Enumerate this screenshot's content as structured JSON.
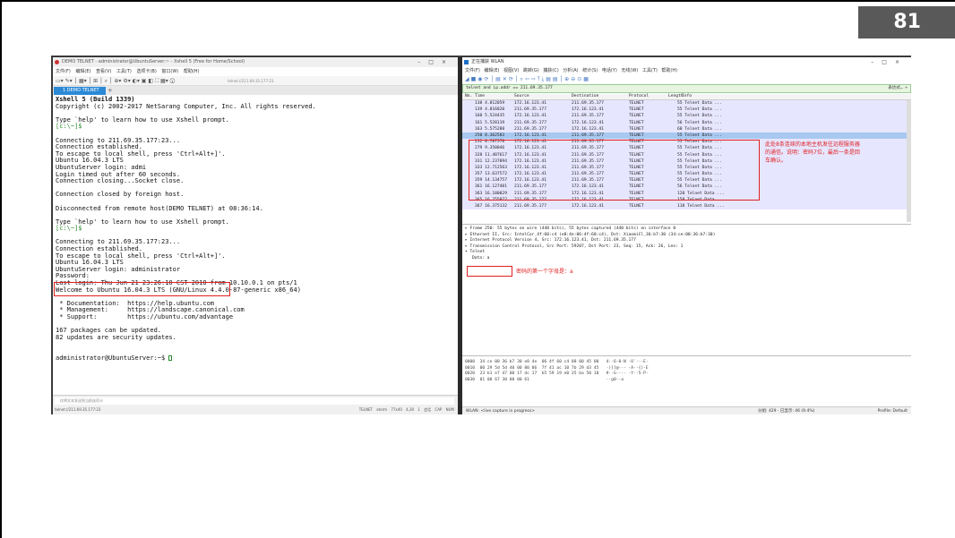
{
  "page_number": "81",
  "xshell": {
    "title": "DEMO TELNET - administrator@UbuntuServer:~ - Xshell 5 (Free for Home/School)",
    "menu": "文件(F) 编辑(E) 查看(V) 工具(T) 选项卡(B) 窗口(W) 帮助(H)",
    "address": "telnet://211.69.35.177:23",
    "tab_label": "1 DEMO TELNET",
    "terminal_lines": [
      {
        "text": "Xshell 5 (Build 1339)",
        "bold": true
      },
      {
        "text": "Copyright (c) 2002-2017 NetSarang Computer, Inc. All rights reserved."
      },
      {
        "text": ""
      },
      {
        "text": "Type `help' to learn how to use Xshell prompt."
      },
      {
        "text": "[c:\\~]$",
        "green": true
      },
      {
        "text": ""
      },
      {
        "text": "Connecting to 211.69.35.177:23..."
      },
      {
        "text": "Connection established."
      },
      {
        "text": "To escape to local shell, press 'Ctrl+Alt+]'."
      },
      {
        "text": "Ubuntu 16.04.3 LTS"
      },
      {
        "text": "UbuntuServer login: admi"
      },
      {
        "text": "Login timed out after 60 seconds."
      },
      {
        "text": "Connection closing...Socket close."
      },
      {
        "text": ""
      },
      {
        "text": "Connection closed by foreign host."
      },
      {
        "text": ""
      },
      {
        "text": "Disconnected from remote host(DEMO TELNET) at 08:36:14."
      },
      {
        "text": ""
      },
      {
        "text": "Type `help' to learn how to use Xshell prompt."
      },
      {
        "text": "[c:\\~]$",
        "green": true
      },
      {
        "text": ""
      },
      {
        "text": "Connecting to 211.69.35.177:23..."
      },
      {
        "text": "Connection established."
      },
      {
        "text": "To escape to local shell, press 'Ctrl+Alt+]'."
      },
      {
        "text": "Ubuntu 16.04.3 LTS"
      },
      {
        "text": "UbuntuServer login: administrator"
      },
      {
        "text": "Password:"
      },
      {
        "text": "Last login: Thu Jun 21 23:26:18 CST 2018 from 10.10.0.1 on pts/1"
      },
      {
        "text": "Welcome to Ubuntu 16.04.3 LTS (GNU/Linux 4.4.0-87-generic x86_64)"
      },
      {
        "text": ""
      },
      {
        "text": " * Documentation:  https://help.ubuntu.com"
      },
      {
        "text": " * Management:     https://landscape.canonical.com"
      },
      {
        "text": " * Support:        https://ubuntu.com/advantage"
      },
      {
        "text": ""
      },
      {
        "text": "167 packages can be updated."
      },
      {
        "text": "82 updates are security updates."
      },
      {
        "text": ""
      },
      {
        "text": ""
      },
      {
        "text": "administrator@UbuntuServer:~$ ",
        "cursor": true
      }
    ],
    "input_hint": "仅将文本发送到当前选项卡",
    "status_left": "telnet://211.69.35.177:23",
    "status_right": "TELNET   xterm   77x40   4,30   1 会话   CAP NUM"
  },
  "wireshark": {
    "title": "正在捕获 WLAN",
    "menu": "文件(F) 编辑(E) 视图(V) 跳转(G) 捕获(C) 分析(A) 统计(S) 电话(Y) 无线(W) 工具(T) 帮助(H)",
    "filter": "telnet and ip.addr == 211.69.35.177",
    "filter_right": "表达式…  +",
    "columns": [
      "No.",
      "Time",
      "Source",
      "Destination",
      "Protocol",
      "Length",
      "Info"
    ],
    "packets": [
      [
        "138",
        "4.812059",
        "172.16.123.41",
        "211.69.35.177",
        "TELNET",
        "55",
        "Telnet Data ..."
      ],
      [
        "139",
        "4.816820",
        "211.69.35.177",
        "172.16.123.41",
        "TELNET",
        "55",
        "Telnet Data ..."
      ],
      [
        "160",
        "5.524435",
        "172.16.123.41",
        "211.69.35.177",
        "TELNET",
        "55",
        "Telnet Data ..."
      ],
      [
        "161",
        "5.528119",
        "211.69.35.177",
        "172.16.123.41",
        "TELNET",
        "56",
        "Telnet Data ..."
      ],
      [
        "163",
        "5.575288",
        "211.69.35.177",
        "172.16.123.41",
        "TELNET",
        "60",
        "Telnet Data ..."
      ],
      [
        "250",
        "8.362583",
        "172.16.123.41",
        "211.69.35.177",
        "TELNET",
        "55",
        "Telnet Data ..."
      ],
      [
        "252",
        "8.787578",
        "172.16.123.41",
        "211.69.35.177",
        "TELNET",
        "55",
        "Telnet Data ..."
      ],
      [
        "279",
        "9.350046",
        "172.16.123.41",
        "211.69.35.177",
        "TELNET",
        "55",
        "Telnet Data ..."
      ],
      [
        "328",
        "11.487617",
        "172.16.123.41",
        "211.69.35.177",
        "TELNET",
        "55",
        "Telnet Data ..."
      ],
      [
        "331",
        "12.237094",
        "172.16.123.41",
        "211.69.35.177",
        "TELNET",
        "55",
        "Telnet Data ..."
      ],
      [
        "333",
        "12.712563",
        "172.16.123.41",
        "211.69.35.177",
        "TELNET",
        "55",
        "Telnet Data ..."
      ],
      [
        "357",
        "13.637572",
        "172.16.123.41",
        "211.69.35.177",
        "TELNET",
        "55",
        "Telnet Data ..."
      ],
      [
        "359",
        "14.134757",
        "172.16.123.41",
        "211.69.35.177",
        "TELNET",
        "55",
        "Telnet Data ..."
      ],
      [
        "361",
        "16.127401",
        "211.69.35.177",
        "172.16.123.41",
        "TELNET",
        "56",
        "Telnet Data ..."
      ],
      [
        "363",
        "16.180029",
        "211.69.35.177",
        "172.16.123.41",
        "TELNET",
        "120",
        "Telnet Data ..."
      ],
      [
        "365",
        "16.255872",
        "211.69.35.177",
        "172.16.123.41",
        "TELNET",
        "158",
        "Telnet Data ..."
      ],
      [
        "367",
        "16.375132",
        "211.69.35.177",
        "172.16.123.41",
        "TELNET",
        "118",
        "Telnet Data ..."
      ]
    ],
    "selected_index": 5,
    "note_packets": "此处8条连续的本地主机发往远程服务器的通信。说明：密码7位，最后一条是回车确认。",
    "details": [
      "Frame 250: 55 bytes on wire (440 bits), 55 bytes captured (440 bits) on interface 0",
      "Ethernet II, Src: IntelCor_4f:60:c4 (e8:4e:06:4f:60:c4), Dst: XiaomiCl_36:b7:30 (34:ce:00:36:b7:30)",
      "Internet Protocol Version 4, Src: 172.16.123.41, Dst: 211.69.35.177",
      "Transmission Control Protocol, Src Port: 59207, Dst Port: 23, Seq: 15, Ack: 26, Len: 1",
      "Telnet",
      "Data: a"
    ],
    "note_data": "密码的第一个字母是：a",
    "hex": [
      "0000  34 ce 00 36 b7 30 e8 4e  06 4f 60 c4 08 00 45 00   4··6·0·N ·O`···E·",
      "0010  00 29 5d 5d 40 00 80 06  7f 41 ac 10 7b 29 d3 45   ·)]]@··· ·A··{)·E",
      "0020  23 b1 e7 47 00 17 dc 17  b5 59 19 e0 35 ba 50 18   #··G···· ·Y··5·P·",
      "0030  01 00 67 30 00 00 61                               ··g0··a"
    ],
    "status_left": "WLAN: <live capture in progress>",
    "status_mid": "分组: 429 · 已显示: 46 (9.4%)",
    "status_right": "Profile: Default"
  }
}
